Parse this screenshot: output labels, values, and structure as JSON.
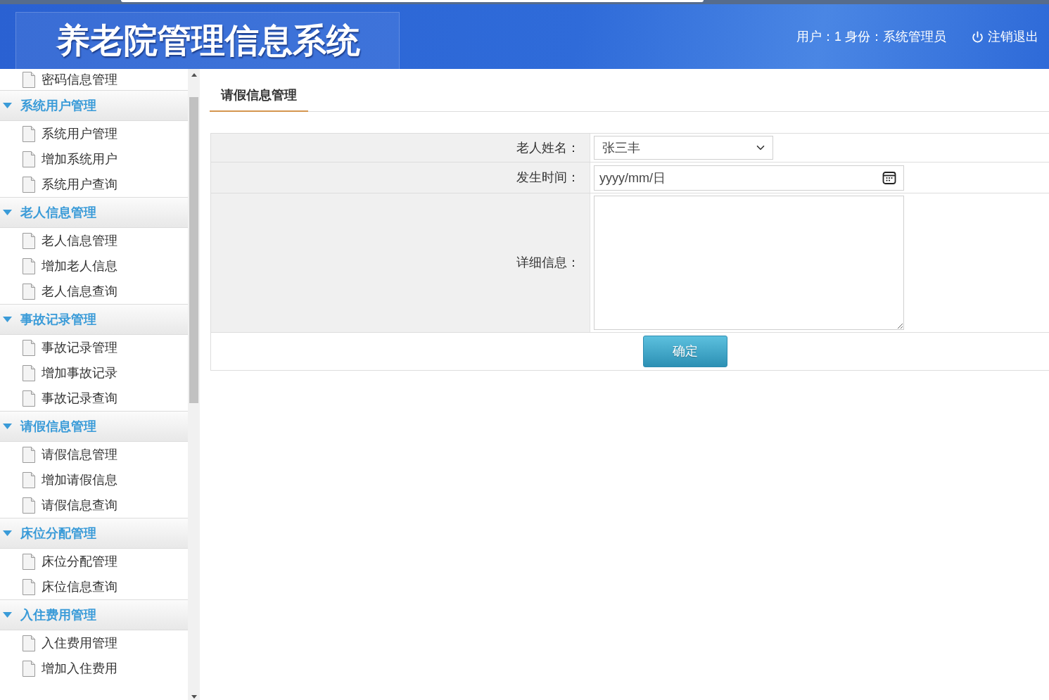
{
  "header": {
    "title": "养老院管理信息系统",
    "user_info": "用户：1 身份：系统管理员",
    "logout": "注销退出"
  },
  "sidebar": {
    "top_items": [
      "密码信息管理"
    ],
    "groups": [
      {
        "title": "系统用户管理",
        "expanded": true,
        "items": [
          "系统用户管理",
          "增加系统用户",
          "系统用户查询"
        ]
      },
      {
        "title": "老人信息管理",
        "expanded": true,
        "items": [
          "老人信息管理",
          "增加老人信息",
          "老人信息查询"
        ]
      },
      {
        "title": "事故记录管理",
        "expanded": true,
        "items": [
          "事故记录管理",
          "增加事故记录",
          "事故记录查询"
        ]
      },
      {
        "title": "请假信息管理",
        "expanded": true,
        "items": [
          "请假信息管理",
          "增加请假信息",
          "请假信息查询"
        ]
      },
      {
        "title": "床位分配管理",
        "expanded": true,
        "items": [
          "床位分配管理",
          "床位信息查询"
        ]
      },
      {
        "title": "入住费用管理",
        "expanded": true,
        "items": [
          "入住费用管理",
          "增加入住费用"
        ]
      }
    ]
  },
  "content": {
    "tabs": [
      {
        "label": "请假信息管理",
        "selected": true
      }
    ],
    "form": {
      "fields": [
        {
          "kind": "select",
          "label": "老人姓名：",
          "value": "张三丰"
        },
        {
          "kind": "date",
          "label": "发生时间：",
          "placeholder": "yyyy/mm/日"
        },
        {
          "kind": "textarea",
          "label": "详细信息："
        }
      ],
      "submit": "确定"
    }
  }
}
